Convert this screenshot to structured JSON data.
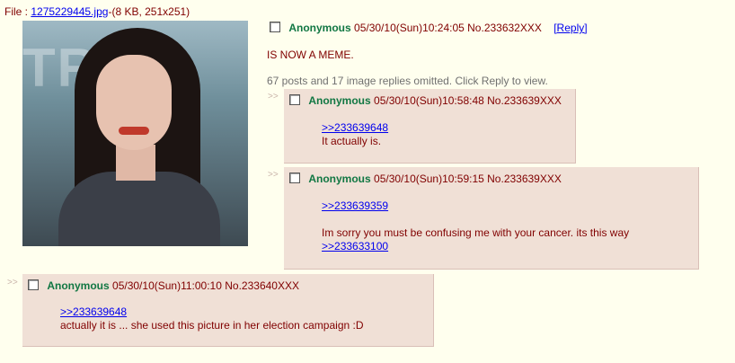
{
  "file": {
    "label": "File :",
    "name": "1275229445.jpg",
    "details": "-(8 KB, 251x251)"
  },
  "op": {
    "name": "Anonymous",
    "datetime": "05/30/10(Sun)10:24:05",
    "number": "No.233632XXX",
    "reply_link": "[Reply]",
    "body": "IS NOW A MEME.",
    "omitted": "67 posts and 17 image replies omitted. Click Reply to view."
  },
  "replies": [
    {
      "arrows": ">>",
      "name": "Anonymous",
      "datetime": "05/30/10(Sun)10:58:48",
      "number": "No.233639XXX",
      "quote1": ">>233639648",
      "text1": "It actually is."
    },
    {
      "arrows": ">>",
      "name": "Anonymous",
      "datetime": "05/30/10(Sun)10:59:15",
      "number": "No.233639XXX",
      "quote1": ">>233639359",
      "text1": "Im sorry you must be confusing me with your cancer. its this way",
      "quote2": ">>233633100"
    },
    {
      "arrows": ">>",
      "name": "Anonymous",
      "datetime": "05/30/10(Sun)11:00:10",
      "number": "No.233640XXX",
      "quote1": ">>233639648",
      "text1": "actually it is ... she used this picture in her election campaign :D"
    }
  ],
  "colors": {
    "background": "#FFFFEE",
    "reply_bg": "#F0E0D6",
    "name": "#117743",
    "text": "#800000",
    "link": "#0000EE"
  }
}
